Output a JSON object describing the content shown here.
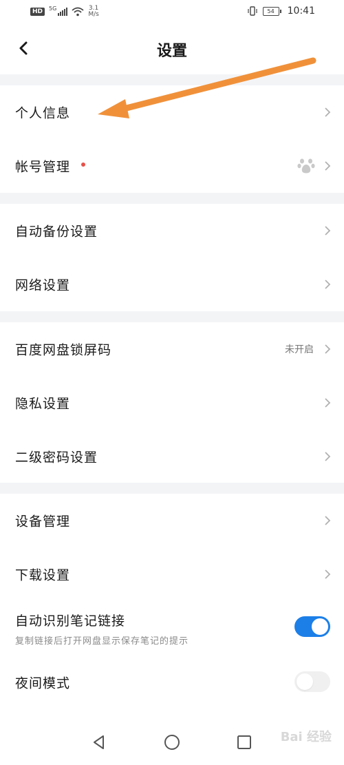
{
  "status": {
    "hd": "HD",
    "net": "5G",
    "speed_value": "3.1",
    "speed_unit": "M/s",
    "battery": "54",
    "time": "10:41"
  },
  "header": {
    "title": "设置"
  },
  "sections": {
    "personal": {
      "label": "个人信息"
    },
    "account": {
      "label": "帐号管理"
    },
    "backup": {
      "label": "自动备份设置"
    },
    "network": {
      "label": "网络设置"
    },
    "lock": {
      "label": "百度网盘锁屏码",
      "value": "未开启"
    },
    "privacy": {
      "label": "隐私设置"
    },
    "password": {
      "label": "二级密码设置"
    },
    "device": {
      "label": "设备管理"
    },
    "download": {
      "label": "下载设置"
    },
    "notelink": {
      "label": "自动识别笔记链接",
      "sub": "复制链接后打开网盘显示保存笔记的提示",
      "enabled": true
    },
    "night": {
      "label": "夜间模式",
      "enabled": false
    }
  },
  "colors": {
    "accent": "#1c7fe8",
    "arrow": "#f0913a",
    "divider": "#f3f4f6",
    "dot": "#e5524a"
  },
  "watermark": "Bai 经验"
}
